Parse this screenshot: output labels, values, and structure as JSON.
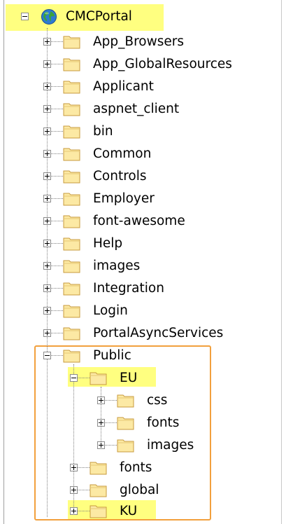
{
  "colors": {
    "highlight": "#ffff80",
    "selection_border": "#f2a03d",
    "folder_fill": "#fce9a4",
    "folder_stroke": "#c79a3e"
  },
  "tree": {
    "root": {
      "label": "CMCPortal",
      "icon": "globe-icon",
      "state": "expanded"
    },
    "children": [
      {
        "label": "App_Browsers",
        "state": "collapsed"
      },
      {
        "label": "App_GlobalResources",
        "state": "collapsed"
      },
      {
        "label": "Applicant",
        "state": "collapsed"
      },
      {
        "label": "aspnet_client",
        "state": "collapsed"
      },
      {
        "label": "bin",
        "state": "collapsed"
      },
      {
        "label": "Common",
        "state": "collapsed"
      },
      {
        "label": "Controls",
        "state": "collapsed"
      },
      {
        "label": "Employer",
        "state": "collapsed"
      },
      {
        "label": "font-awesome",
        "state": "collapsed"
      },
      {
        "label": "Help",
        "state": "collapsed"
      },
      {
        "label": "images",
        "state": "collapsed"
      },
      {
        "label": "Integration",
        "state": "collapsed"
      },
      {
        "label": "Login",
        "state": "collapsed"
      },
      {
        "label": "PortalAsyncServices",
        "state": "collapsed"
      }
    ],
    "public": {
      "label": "Public",
      "state": "expanded",
      "children": [
        {
          "label": "EU",
          "state": "expanded",
          "highlighted": true,
          "children": [
            {
              "label": "css",
              "state": "collapsed"
            },
            {
              "label": "fonts",
              "state": "collapsed"
            },
            {
              "label": "images",
              "state": "collapsed"
            }
          ]
        },
        {
          "label": "fonts",
          "state": "collapsed"
        },
        {
          "label": "global",
          "state": "collapsed"
        },
        {
          "label": "KU",
          "state": "collapsed",
          "highlighted": true
        }
      ]
    }
  }
}
